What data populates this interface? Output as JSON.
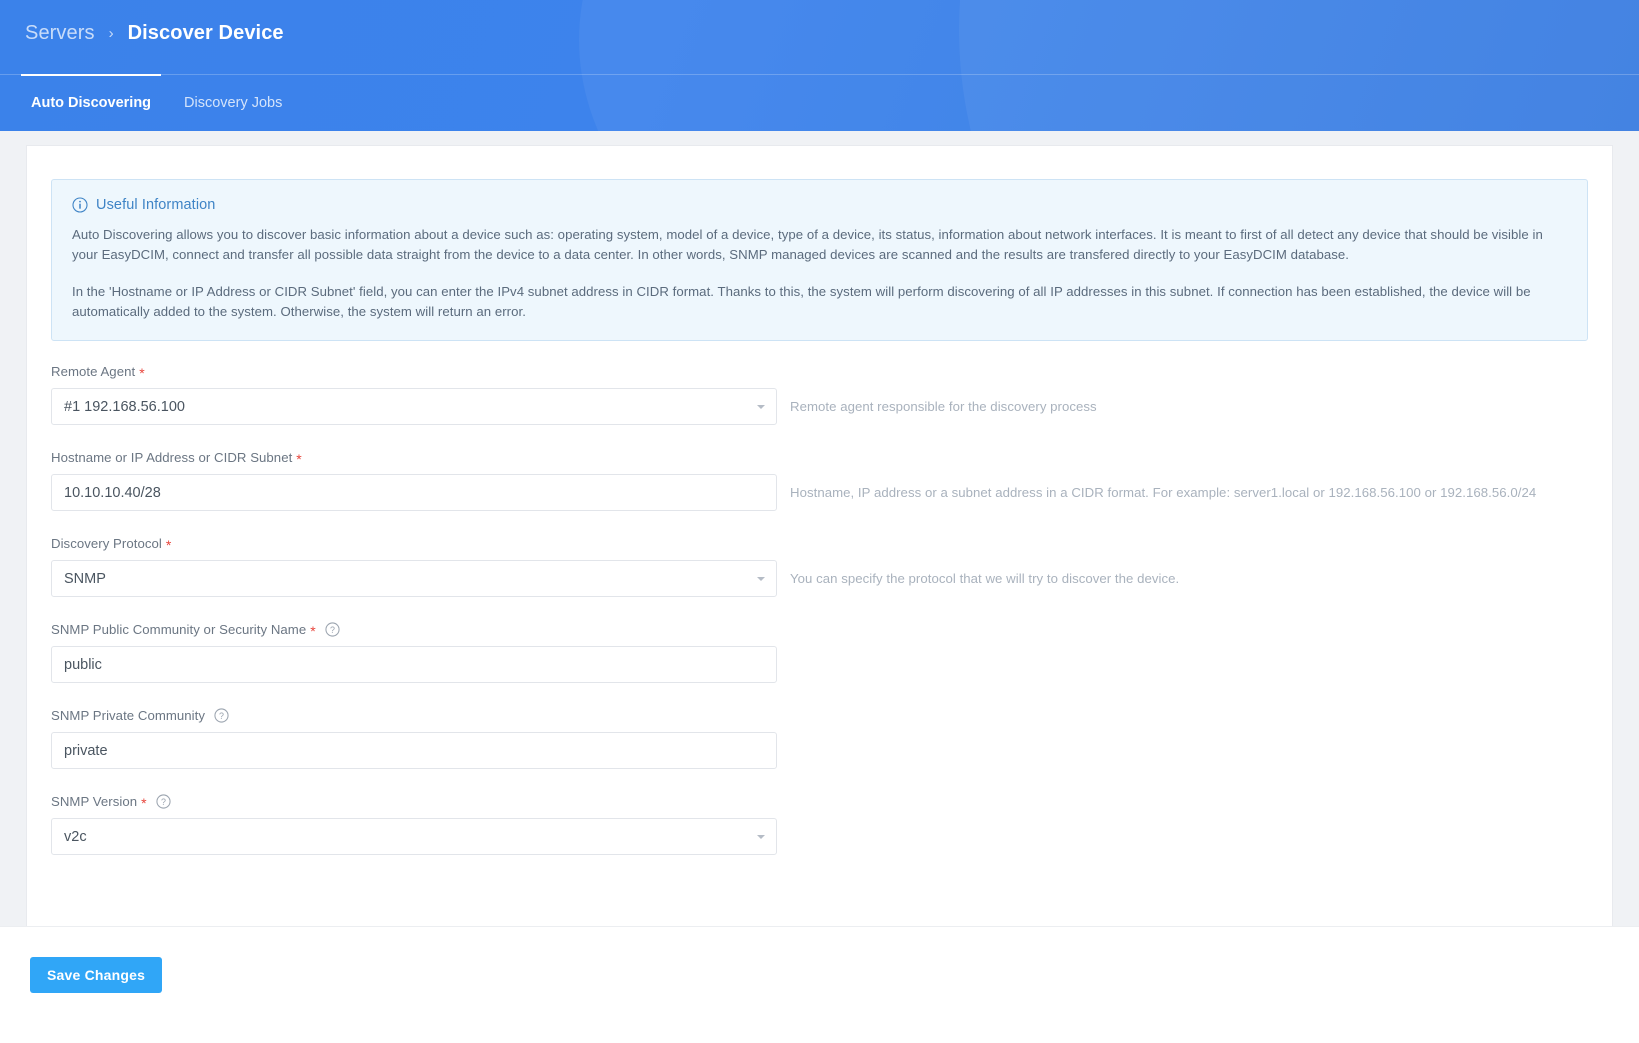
{
  "header": {
    "breadcrumb_root": "Servers",
    "breadcrumb_separator": "›",
    "breadcrumb_current": "Discover Device",
    "tabs": [
      {
        "label": "Auto Discovering",
        "active": true
      },
      {
        "label": "Discovery Jobs",
        "active": false
      }
    ]
  },
  "info_box": {
    "title": "Useful Information",
    "icon": "info-circle-icon",
    "paragraph_1": "Auto Discovering allows you to discover basic information about a device such as: operating system, model of a device, type of a device, its status, information about network interfaces. It is meant to first of all detect any device that should be visible in your EasyDCIM, connect and transfer all possible data straight from the device to a data center. In other words, SNMP managed devices are scanned and the results are transfered directly to your EasyDCIM database.",
    "paragraph_2": "In the 'Hostname or IP Address or CIDR Subnet' field, you can enter the IPv4 subnet address in CIDR format. Thanks to this, the system will perform discovering of all IP addresses in this subnet. If connection has been established, the device will be automatically added to the system. Otherwise, the system will return an error."
  },
  "form": {
    "remote_agent": {
      "label": "Remote Agent",
      "required": "*",
      "value": "#1 192.168.56.100",
      "help": "Remote agent responsible for the discovery process",
      "type": "select"
    },
    "hostname": {
      "label": "Hostname or IP Address or CIDR Subnet",
      "required": "*",
      "value": "10.10.10.40/28",
      "help": "Hostname, IP address or a subnet address in a CIDR format. For example: server1.local or 192.168.56.100 or 192.168.56.0/24",
      "type": "text"
    },
    "discovery_protocol": {
      "label": "Discovery Protocol",
      "required": "*",
      "value": "SNMP",
      "help": "You can specify the protocol that we will try to discover the device.",
      "type": "select"
    },
    "snmp_public": {
      "label": "SNMP Public Community or Security Name",
      "required": "*",
      "value": "public",
      "help": "",
      "type": "text",
      "has_help_icon": true
    },
    "snmp_private": {
      "label": "SNMP Private Community",
      "required": "",
      "value": "private",
      "help": "",
      "type": "text",
      "has_help_icon": true
    },
    "snmp_version": {
      "label": "SNMP Version",
      "required": "*",
      "value": "v2c",
      "help": "",
      "type": "select",
      "has_help_icon": true
    }
  },
  "footer": {
    "save_label": "Save Changes"
  },
  "colors": {
    "header_blue": "#3b82ea",
    "accent_blue": "#30a6f7",
    "info_bg": "#eef7fd",
    "info_border": "#cde3f5",
    "required_red": "#e8453c",
    "page_bg": "#f0f2f5"
  }
}
